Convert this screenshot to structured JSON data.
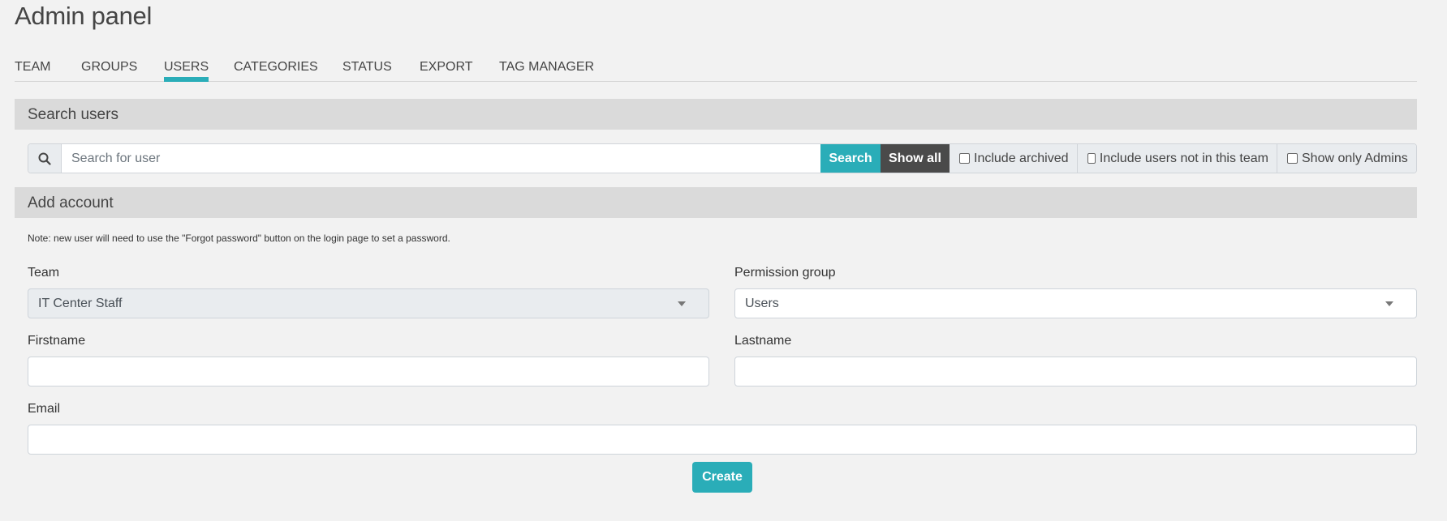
{
  "page": {
    "title": "Admin panel"
  },
  "nav": {
    "items": [
      {
        "label": "TEAM",
        "active": false
      },
      {
        "label": "GROUPS",
        "active": false
      },
      {
        "label": "USERS",
        "active": true
      },
      {
        "label": "CATEGORIES",
        "active": false
      },
      {
        "label": "STATUS",
        "active": false
      },
      {
        "label": "EXPORT",
        "active": false
      },
      {
        "label": "TAG MANAGER",
        "active": false
      }
    ]
  },
  "search_section": {
    "heading": "Search users",
    "icon": "search-icon",
    "input_placeholder": "Search for user",
    "input_value": "",
    "search_button": "Search",
    "show_all_button": "Show all",
    "checkboxes": [
      {
        "label": "Include archived",
        "checked": false
      },
      {
        "label": "Include users not in this team",
        "checked": false
      },
      {
        "label": "Show only Admins",
        "checked": false
      }
    ]
  },
  "add_account": {
    "heading": "Add account",
    "note": "Note: new user will need to use the \"Forgot password\" button on the login page to set a password.",
    "team_label": "Team",
    "team_value": "IT Center Staff",
    "permission_label": "Permission group",
    "permission_value": "Users",
    "firstname_label": "Firstname",
    "firstname_value": "",
    "lastname_label": "Lastname",
    "lastname_value": "",
    "email_label": "Email",
    "email_value": "",
    "create_button": "Create"
  },
  "colors": {
    "accent": "#2aadb8",
    "dark_button": "#4a4a4a",
    "section_bar": "#dadada",
    "background": "#f2f2f2"
  }
}
